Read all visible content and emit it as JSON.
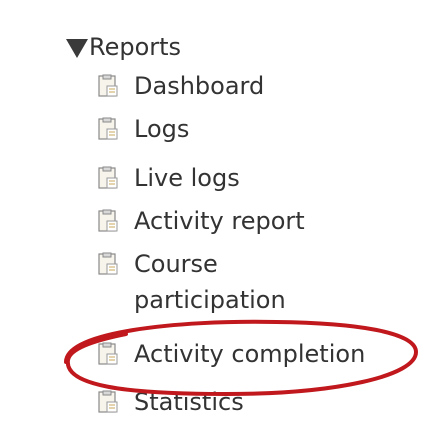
{
  "tree": {
    "root_label": "Reports",
    "items": [
      {
        "label": "Dashboard"
      },
      {
        "label": "Logs"
      },
      {
        "label": "Live logs"
      },
      {
        "label": "Activity report"
      },
      {
        "label_line1": "Course",
        "label_line2": "participation"
      },
      {
        "label": "Activity completion"
      },
      {
        "label": "Statistics"
      }
    ]
  },
  "colors": {
    "text": "#333333",
    "highlight": "#c0181c",
    "icon_fill": "#f7f4ec",
    "icon_border": "#8a8a8a"
  }
}
